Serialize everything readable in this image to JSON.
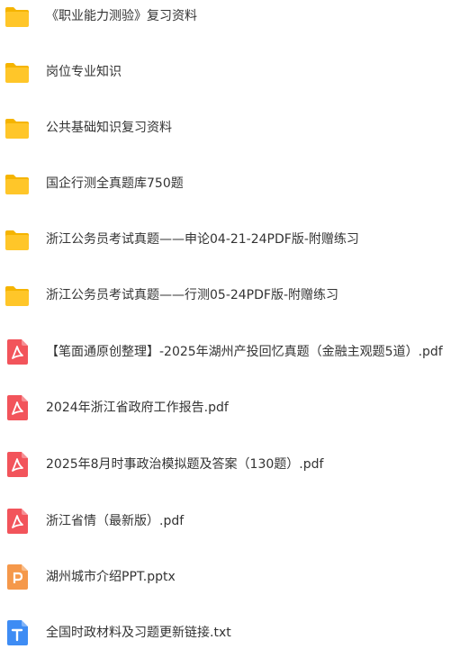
{
  "colors": {
    "folder": "#FFC629",
    "folder_tab": "#F5B400",
    "pdf": "#F2545B",
    "pptx": "#F5984A",
    "txt": "#3E8CF4",
    "text": "#333333"
  },
  "files": [
    {
      "name": "《职业能力测验》复习资料",
      "type": "folder",
      "icon": "folder-icon"
    },
    {
      "name": "岗位专业知识",
      "type": "folder",
      "icon": "folder-icon"
    },
    {
      "name": "公共基础知识复习资料",
      "type": "folder",
      "icon": "folder-icon"
    },
    {
      "name": "国企行测全真题库750题",
      "type": "folder",
      "icon": "folder-icon"
    },
    {
      "name": "浙江公务员考试真题——申论04-21-24PDF版-附赠练习",
      "type": "folder",
      "icon": "folder-icon"
    },
    {
      "name": "浙江公务员考试真题——行测05-24PDF版-附赠练习",
      "type": "folder",
      "icon": "folder-icon"
    },
    {
      "name": "【笔面通原创整理】-2025年湖州产投回忆真题（金融主观题5道）.pdf",
      "type": "pdf",
      "icon": "pdf-icon"
    },
    {
      "name": "2024年浙江省政府工作报告.pdf",
      "type": "pdf",
      "icon": "pdf-icon"
    },
    {
      "name": "2025年8月时事政治模拟题及答案（130题）.pdf",
      "type": "pdf",
      "icon": "pdf-icon"
    },
    {
      "name": "浙江省情（最新版）.pdf",
      "type": "pdf",
      "icon": "pdf-icon"
    },
    {
      "name": "湖州城市介绍PPT.pptx",
      "type": "pptx",
      "icon": "pptx-icon"
    },
    {
      "name": "全国时政材料及习题更新链接.txt",
      "type": "txt",
      "icon": "txt-icon"
    }
  ]
}
